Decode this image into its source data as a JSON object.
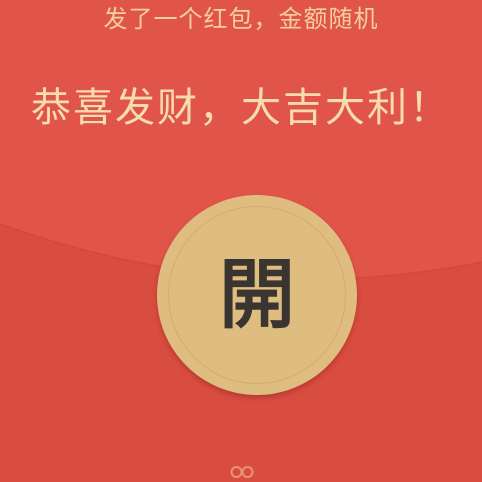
{
  "envelope": {
    "subtitle": "发了一个红包，金额随机",
    "greeting": "恭喜发财，大吉大利！",
    "open_button_label": "開",
    "colors": {
      "flap": "#e1544a",
      "body": "#d94c40",
      "text_gold": "#f2cfa1",
      "button_gold": "#dfbc80",
      "button_text": "#3a3530"
    },
    "icons": {
      "bottom_mark": "wechat-logo-icon"
    }
  }
}
